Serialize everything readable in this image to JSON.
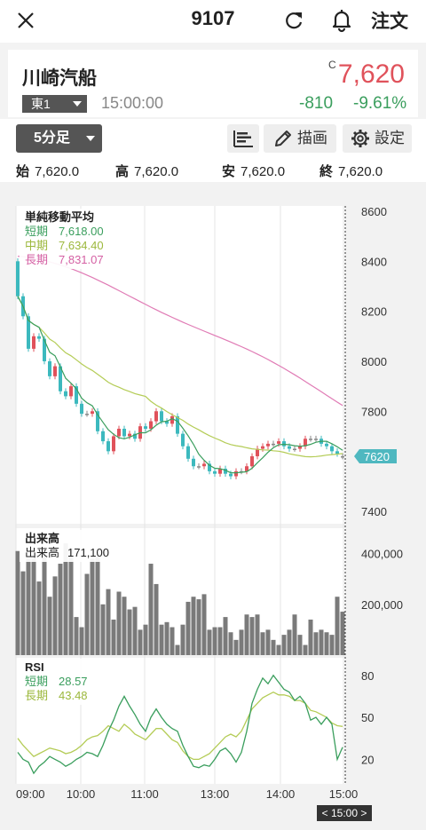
{
  "header": {
    "stock_code": "9107",
    "order_label": "注文"
  },
  "stock": {
    "name": "川崎汽船",
    "price_flag": "C",
    "price": "7,620",
    "market": "東1",
    "time": "15:00:00",
    "change": "-810",
    "change_pct": "-9.61%",
    "colors": {
      "price": "#e0525b",
      "change": "#3a9e5d"
    }
  },
  "toolbar": {
    "interval": "5分足",
    "draw_label": "描画",
    "settings_label": "設定"
  },
  "ohlc": [
    {
      "label": "始",
      "value": "7,620.0"
    },
    {
      "label": "高",
      "value": "7,620.0"
    },
    {
      "label": "安",
      "value": "7,620.0"
    },
    {
      "label": "終",
      "value": "7,620.0"
    }
  ],
  "legends": {
    "sma_title": "単純移動平均",
    "sma_rows": [
      {
        "label": "短期",
        "value": "7,618.00"
      },
      {
        "label": "中期",
        "value": "7,634.40"
      },
      {
        "label": "長期",
        "value": "7,831.07"
      }
    ],
    "volume_title": "出来高",
    "volume_row": {
      "label": "出来高",
      "value": "171,100"
    },
    "rsi_title": "RSI",
    "rsi_rows": [
      {
        "label": "短期",
        "value": "28.57"
      },
      {
        "label": "長期",
        "value": "43.48"
      }
    ]
  },
  "chart_data": [
    {
      "type": "candlestick",
      "ylim": [
        7350,
        8600
      ],
      "yticks": [
        "8600",
        "8400",
        "8200",
        "8000",
        "7800",
        "7400"
      ],
      "x_labels": [
        "09:00",
        "10:00",
        "11:00",
        "13:00",
        "14:00",
        "15:00"
      ],
      "last_price_label": "7620",
      "cursor_label": "< 15:00 >",
      "colors": {
        "up": "#e0525b",
        "down": "#3cb9be",
        "short": "#3a9e5d",
        "mid": "#b4cc56",
        "long": "#e07bb5",
        "volume": "#7a7a7a"
      },
      "close": [
        8260,
        8180,
        8050,
        8100,
        8090,
        8000,
        7940,
        7980,
        7880,
        7860,
        7900,
        7830,
        7790,
        7790,
        7800,
        7720,
        7680,
        7640,
        7700,
        7730,
        7700,
        7710,
        7690,
        7740,
        7730,
        7760,
        7800,
        7760,
        7750,
        7780,
        7710,
        7660,
        7610,
        7580,
        7580,
        7590,
        7560,
        7550,
        7570,
        7550,
        7540,
        7560,
        7560,
        7580,
        7620,
        7650,
        7660,
        7670,
        7670,
        7680,
        7660,
        7650,
        7650,
        7660,
        7690,
        7690,
        7690,
        7670,
        7660,
        7640,
        7630,
        7620
      ],
      "volume": [
        410000,
        330000,
        380000,
        380000,
        290000,
        420000,
        230000,
        310000,
        360000,
        440000,
        420000,
        150000,
        110000,
        320000,
        380000,
        390000,
        200000,
        260000,
        140000,
        250000,
        230000,
        180000,
        190000,
        100000,
        120000,
        360000,
        280000,
        120000,
        130000,
        110000,
        40000,
        120000,
        210000,
        230000,
        220000,
        240000,
        100000,
        110000,
        110000,
        150000,
        90000,
        60000,
        100000,
        160000,
        150000,
        160000,
        90000,
        100000,
        60000,
        40000,
        80000,
        100000,
        160000,
        80000,
        40000,
        140000,
        90000,
        100000,
        90000,
        80000,
        230000,
        171100
      ],
      "rsi_short": [
        25,
        20,
        18,
        10,
        15,
        18,
        22,
        20,
        18,
        15,
        17,
        20,
        22,
        25,
        24,
        22,
        30,
        40,
        48,
        58,
        65,
        58,
        52,
        45,
        40,
        50,
        56,
        50,
        45,
        42,
        40,
        30,
        22,
        15,
        14,
        16,
        15,
        20,
        26,
        28,
        24,
        18,
        25,
        40,
        60,
        70,
        78,
        74,
        80,
        75,
        70,
        68,
        62,
        65,
        60,
        48,
        50,
        45,
        50,
        45,
        20,
        28.57
      ],
      "rsi_long": [
        35,
        30,
        26,
        22,
        24,
        26,
        28,
        27,
        26,
        24,
        25,
        27,
        30,
        34,
        36,
        37,
        40,
        44,
        42,
        40,
        45,
        42,
        38,
        36,
        34,
        38,
        42,
        42,
        38,
        34,
        32,
        26,
        22,
        20,
        20,
        22,
        24,
        28,
        32,
        36,
        38,
        36,
        40,
        48,
        56,
        60,
        64,
        66,
        68,
        66,
        66,
        65,
        62,
        62,
        60,
        55,
        54,
        52,
        50,
        46,
        44,
        43.48
      ],
      "rsi_ticks": [
        "80",
        "50",
        "20"
      ]
    },
    {
      "type": "bar",
      "name": "出来高",
      "yticks": [
        "400,000",
        "200,000"
      ]
    }
  ]
}
